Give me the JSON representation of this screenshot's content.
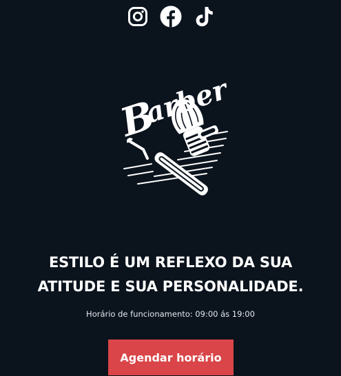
{
  "social": {
    "items": [
      {
        "icon": "instagram-icon",
        "label": "Instagram"
      },
      {
        "icon": "facebook-icon",
        "label": "Facebook"
      },
      {
        "icon": "tiktok-icon",
        "label": "TikTok"
      }
    ]
  },
  "logo": {
    "text": "Barber"
  },
  "hero": {
    "headline_line1": "ESTILO É UM REFLEXO DA SUA",
    "headline_line2": "ATITUDE E SUA PERSONALIDADE.",
    "hours": "Horário de funcionamento: 09:00 ás 19:00"
  },
  "cta": {
    "label": "Agendar horário",
    "color": "#d94548"
  },
  "colors": {
    "background": "#0b131d",
    "text": "#ffffff"
  }
}
